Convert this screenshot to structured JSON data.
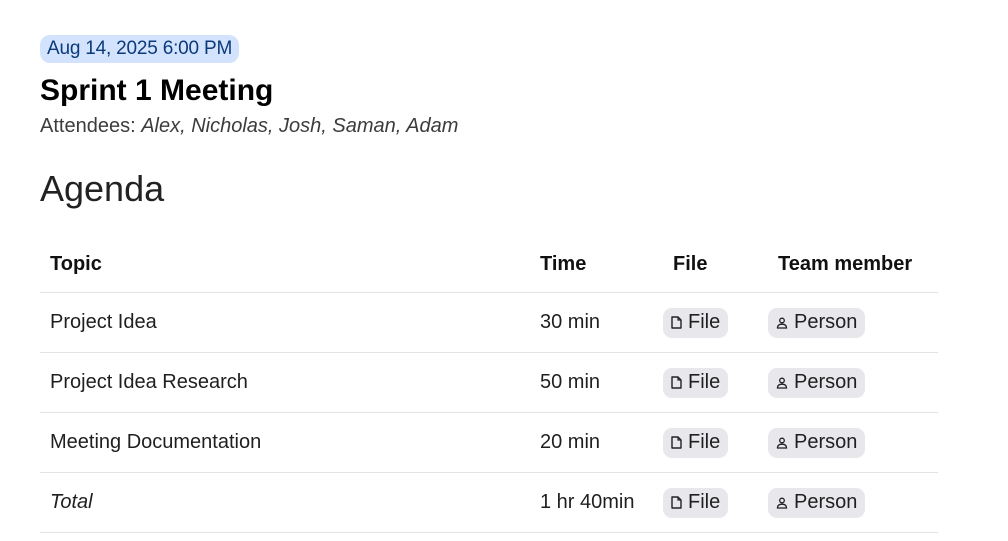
{
  "meeting": {
    "date": "Aug 14, 2025 6:00 PM",
    "title": "Sprint 1 Meeting",
    "attendees_label": "Attendees:",
    "attendees": "Alex, Nicholas, Josh, Saman, Adam"
  },
  "agenda": {
    "heading": "Agenda",
    "columns": {
      "topic": "Topic",
      "time": "Time",
      "file": "File",
      "member": "Team member"
    },
    "rows": [
      {
        "topic": "Project Idea",
        "time": "30 min",
        "file": "File",
        "member": "Person"
      },
      {
        "topic": "Project Idea Research",
        "time": "50 min",
        "file": "File",
        "member": "Person"
      },
      {
        "topic": "Meeting Documentation",
        "time": "20 min",
        "file": "File",
        "member": "Person"
      },
      {
        "topic": "Total",
        "time": "1 hr 40min",
        "file": "File",
        "member": "Person"
      }
    ]
  },
  "icons": {
    "file": "file-icon",
    "person": "person-icon"
  },
  "colors": {
    "date_chip_bg": "#d3e3fd",
    "date_chip_text": "#0b3a7a",
    "chip_bg": "#e8e8ec"
  }
}
